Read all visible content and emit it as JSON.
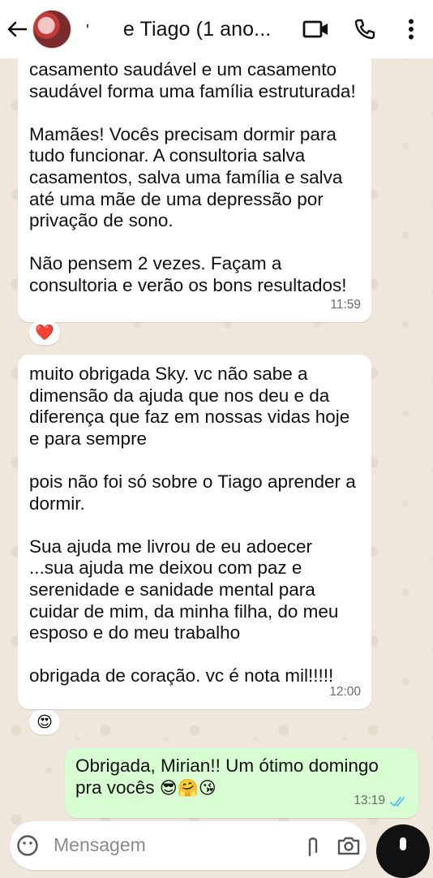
{
  "header": {
    "title": "e Tiago (1 ano...",
    "title_prefix": "'",
    "back_icon": "arrow-left-icon",
    "video_icon": "video-call-icon",
    "call_icon": "phone-icon",
    "more_icon": "more-vertical-icon"
  },
  "messages": [
    {
      "direction": "incoming",
      "paragraphs": [
        "casamento saudável e um casamento saudável forma uma família estruturada!",
        "Mamães! Vocês precisam dormir para tudo funcionar. A consultoria salva casamentos, salva uma família e salva até uma mãe de uma depressão por privação de sono.",
        "Não pensem 2 vezes. Façam a consultoria e verão os bons resultados!"
      ],
      "time": "11:59",
      "reaction": "❤️"
    },
    {
      "direction": "incoming",
      "paragraphs": [
        "muito obrigada Sky. vc não sabe a dimensão da ajuda que nos deu e da diferença que faz em nossas vidas hoje e para sempre",
        "pois não foi só sobre o Tiago aprender a dormir.",
        "Sua ajuda me livrou de eu adoecer ...sua ajuda me deixou com paz e serenidade e sanidade mental para cuidar de mim, da minha filha, do meu esposo  e do meu trabalho",
        "obrigada de coração.  vc é nota mil!!!!!"
      ],
      "time": "12:00",
      "reaction": "😍"
    },
    {
      "direction": "outgoing",
      "text": "Obrigada, Mirian!! Um ótimo domingo pra vocês",
      "emojis": "😎🤗😘",
      "time": "13:19",
      "status": "read"
    }
  ],
  "input": {
    "placeholder": "Mensagem",
    "emoji_icon": "emoji-icon",
    "attach_icon": "paperclip-icon",
    "camera_icon": "camera-icon",
    "mic_icon": "mic-icon"
  },
  "colors": {
    "outgoing_bubble": "#d9fdd3",
    "incoming_bubble": "#ffffff",
    "read_ticks": "#53bdeb",
    "wallpaper": "#efe7dc"
  }
}
